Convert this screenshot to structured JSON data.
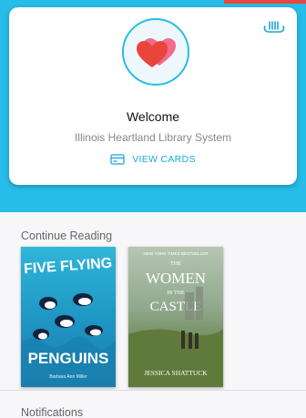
{
  "profile": {
    "welcome": "Welcome",
    "library_name": "Illinois Heartland Library System",
    "view_cards_label": "VIEW CARDS"
  },
  "continue_reading": {
    "title": "Continue Reading",
    "books": [
      {
        "title_line1": "FIVE FLYING",
        "title_line2": "PENGUINS",
        "author": "Barbara Ann Miller"
      },
      {
        "badge": "NEW YORK TIMES BESTSELLER",
        "title_line1": "THE",
        "title_line2": "WOMEN",
        "title_line3": "IN THE",
        "title_line4": "CASTLE",
        "author": "JESSICA SHATTUCK"
      }
    ]
  },
  "notifications": {
    "title": "Notifications"
  },
  "colors": {
    "accent": "#27bde8",
    "link": "#1aa7d9",
    "heart": "#e8453c"
  },
  "icons": {
    "scan": "barcode-scan-icon",
    "avatar": "hearts-icon",
    "cards": "card-icon"
  }
}
